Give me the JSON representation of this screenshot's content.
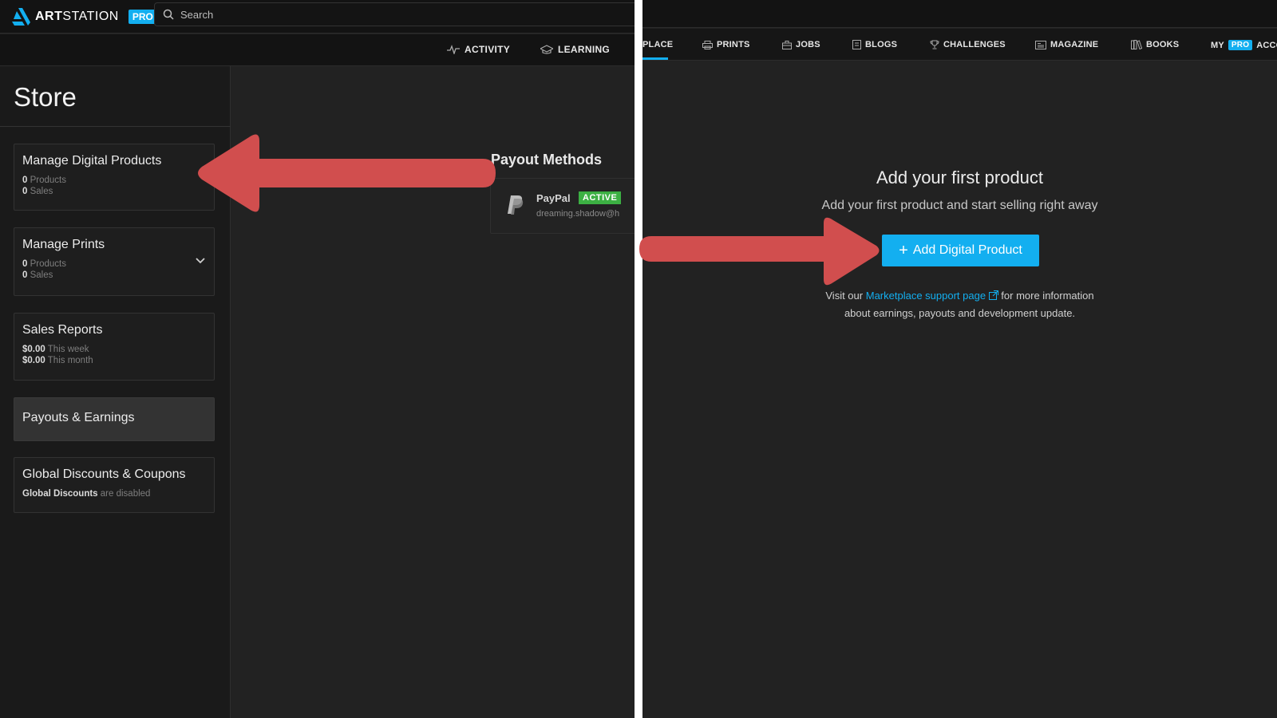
{
  "left": {
    "brand": {
      "name_bold": "ART",
      "name_light": "STATION",
      "pro": "PRO"
    },
    "search": {
      "placeholder": "Search"
    },
    "subnav": [
      {
        "label": "ACTIVITY",
        "icon": "activity-icon"
      },
      {
        "label": "LEARNING",
        "icon": "graduation-cap-icon"
      }
    ],
    "store_title": "Store",
    "cards": [
      {
        "title": "Manage Digital Products",
        "stats": [
          {
            "value": "0",
            "label": "Products"
          },
          {
            "value": "0",
            "label": "Sales"
          }
        ]
      },
      {
        "title": "Manage Prints",
        "stats": [
          {
            "value": "0",
            "label": "Products"
          },
          {
            "value": "0",
            "label": "Sales"
          }
        ]
      },
      {
        "title": "Sales Reports",
        "stats": [
          {
            "value": "$0.00",
            "label": "This week"
          },
          {
            "value": "$0.00",
            "label": "This month"
          }
        ]
      },
      {
        "title": "Payouts & Earnings"
      },
      {
        "title": "Global Discounts & Coupons",
        "stats": [
          {
            "value": "Global Discounts",
            "label": "are disabled"
          }
        ]
      }
    ],
    "payout": {
      "title": "Payout Methods",
      "method": "PayPal",
      "status": "ACTIVE",
      "email": "dreaming.shadow@h"
    }
  },
  "right": {
    "nav": [
      {
        "label": "PLACE"
      },
      {
        "label": "PRINTS",
        "icon": "prints-icon"
      },
      {
        "label": "JOBS",
        "icon": "briefcase-icon"
      },
      {
        "label": "BLOGS",
        "icon": "blog-icon"
      },
      {
        "label": "CHALLENGES",
        "icon": "trophy-icon"
      },
      {
        "label": "MAGAZINE",
        "icon": "magazine-icon"
      },
      {
        "label": "BOOKS",
        "icon": "books-icon"
      },
      {
        "label": "MY",
        "pro": "PRO",
        "suffix": "ACCO"
      }
    ],
    "empty_title": "Add your first product",
    "empty_sub": "Add your first product and start selling right away",
    "add_button": "Add Digital Product",
    "info_prefix": "Visit our",
    "info_link": "Marketplace support page",
    "info_suffix": "for more information",
    "info_line2": "about earnings, payouts and development update."
  },
  "colors": {
    "accent": "#13aff0",
    "arrow": "#d14e4e",
    "active_badge": "#3cb043",
    "background": "#222222"
  }
}
